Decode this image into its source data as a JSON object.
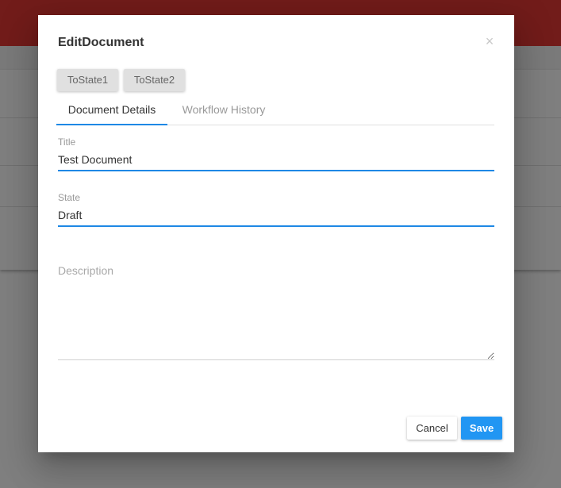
{
  "dialog": {
    "title": "EditDocument",
    "close_icon": "close-icon"
  },
  "workflow_buttons": [
    {
      "label": "ToState1"
    },
    {
      "label": "ToState2"
    }
  ],
  "tabs": [
    {
      "label": "Document Details",
      "active": true
    },
    {
      "label": "Workflow History",
      "active": false
    }
  ],
  "form": {
    "title": {
      "label": "Title",
      "value": "Test Document"
    },
    "state": {
      "label": "State",
      "value": "Draft"
    },
    "description": {
      "placeholder": "Description",
      "value": ""
    }
  },
  "actions": {
    "cancel_label": "Cancel",
    "save_label": "Save"
  },
  "colors": {
    "header": "#e53935",
    "accent": "#1e88e5",
    "save_button": "#2196f3"
  }
}
